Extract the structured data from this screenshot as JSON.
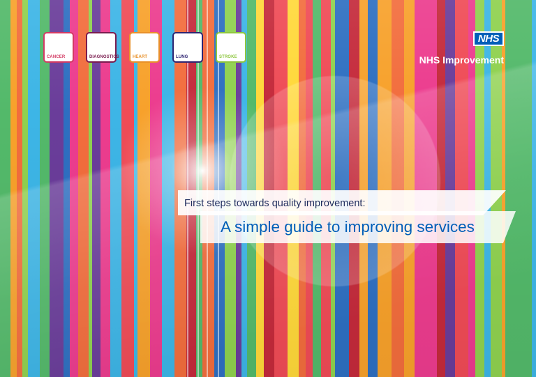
{
  "specialties": [
    {
      "label": "CANCER",
      "color": "#d33a63"
    },
    {
      "label": "DIAGNOSTICS",
      "color": "#7a1c4f"
    },
    {
      "label": "HEART",
      "color": "#e8912a"
    },
    {
      "label": "LUNG",
      "color": "#2e2572"
    },
    {
      "label": "STROKE",
      "color": "#8ec63f"
    }
  ],
  "organisation": {
    "logo_text": "NHS",
    "name": "NHS Improvement"
  },
  "cover": {
    "subtitle": "First steps towards quality improvement:",
    "title": "A simple guide to improving services"
  },
  "colors": {
    "nhs_blue": "#005eb8",
    "navy_text": "#1e2b5c",
    "stripe_palette": [
      "#ef4b56",
      "#f7a12b",
      "#ffd83a",
      "#8fd14f",
      "#3db5e6",
      "#2e6fc1",
      "#6a3d9a",
      "#ec3c8e",
      "#c42a3b",
      "#f26d3d",
      "#53b96a",
      "#1fa7a0"
    ]
  }
}
